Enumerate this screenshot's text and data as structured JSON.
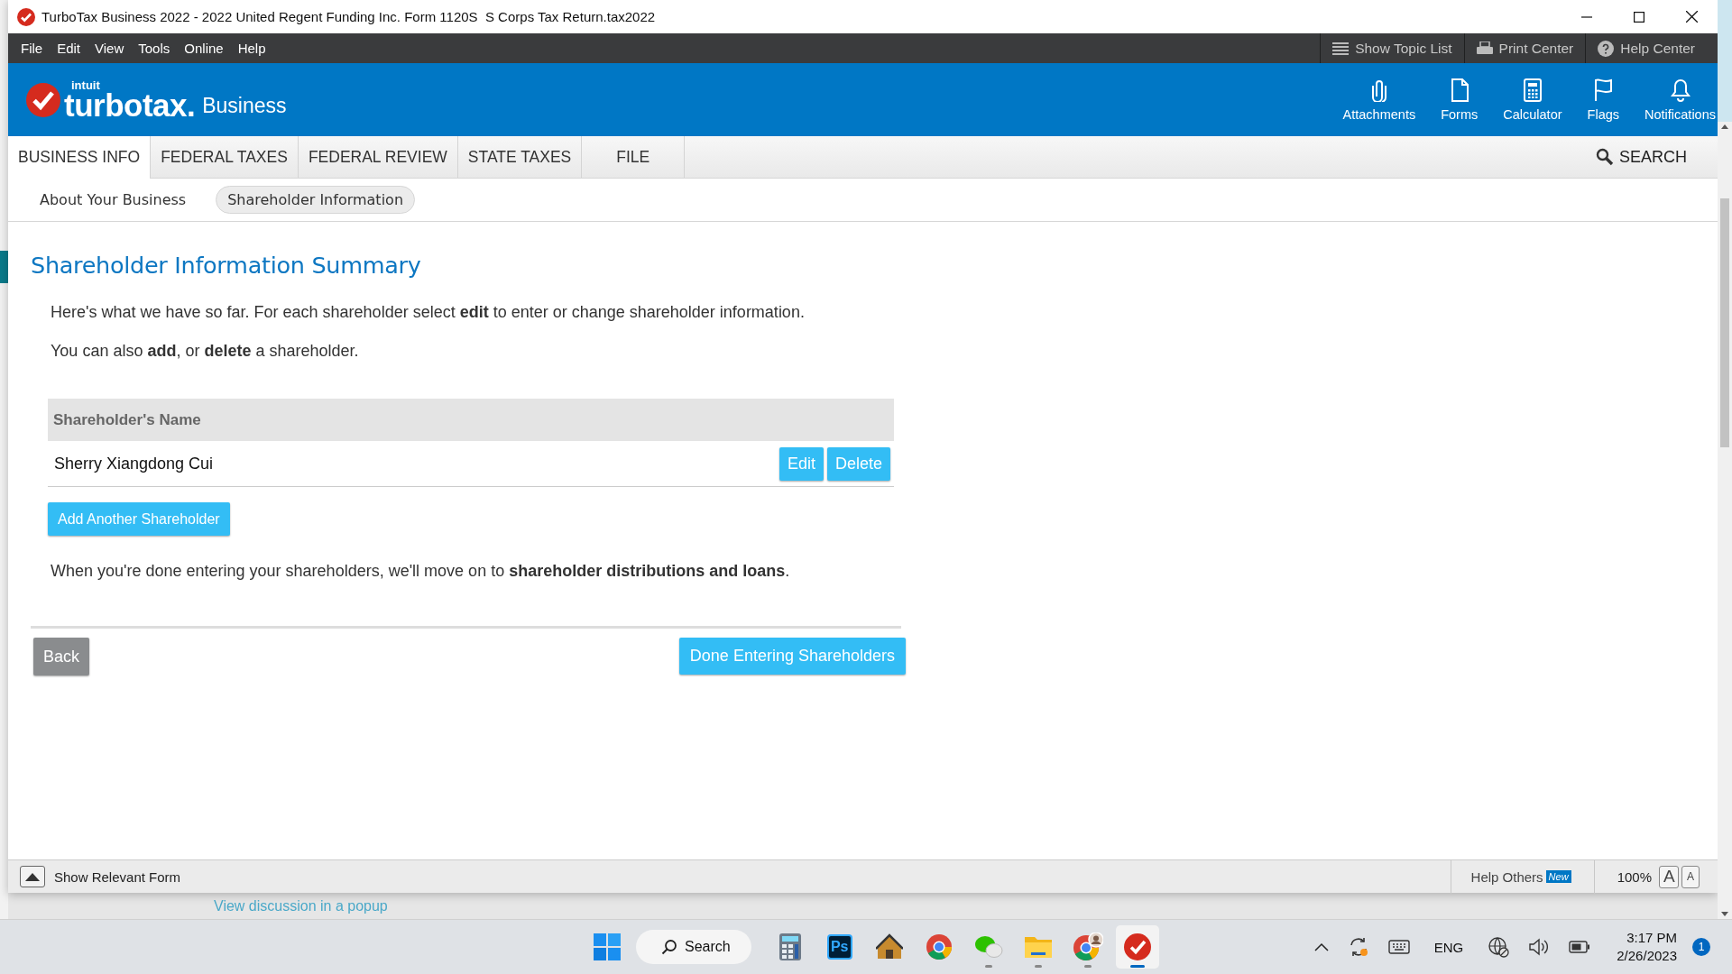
{
  "window": {
    "title": "TurboTax Business 2022 - 2022 United Regent Funding Inc. Form 1120S  S Corps Tax Return.tax2022"
  },
  "menu": [
    "File",
    "Edit",
    "View",
    "Tools",
    "Online",
    "Help"
  ],
  "top_tools": [
    {
      "kind": "list",
      "label": "Show Topic List"
    },
    {
      "kind": "print",
      "label": "Print Center"
    },
    {
      "kind": "help",
      "label": "Help Center"
    }
  ],
  "brand": {
    "small": "intuit",
    "name": "turbotax.",
    "suffix": "Business"
  },
  "header_actions": [
    {
      "kind": "attachments",
      "label": "Attachments"
    },
    {
      "kind": "forms",
      "label": "Forms"
    },
    {
      "kind": "calculator",
      "label": "Calculator"
    },
    {
      "kind": "flags",
      "label": "Flags"
    },
    {
      "kind": "notifications",
      "label": "Notifications"
    }
  ],
  "tabs": [
    {
      "label": "BUSINESS INFO",
      "selected": true
    },
    {
      "label": "FEDERAL TAXES",
      "selected": false
    },
    {
      "label": "FEDERAL REVIEW",
      "selected": false
    },
    {
      "label": "STATE TAXES",
      "selected": false
    },
    {
      "label": "FILE",
      "selected": false
    }
  ],
  "search": {
    "label": "SEARCH"
  },
  "subnav": [
    {
      "label": "About Your Business",
      "selected": false
    },
    {
      "label": "Shareholder Information",
      "selected": true
    }
  ],
  "page": {
    "heading": "Shareholder Information Summary",
    "intro": [
      "Here's what we have so far. For each shareholder select **edit** to enter or change shareholder information.",
      "You can also **add**, or **delete** a shareholder."
    ],
    "table": {
      "columns": [
        "Shareholder's Name"
      ],
      "rows": [
        {
          "name": "Sherry Xiangdong Cui",
          "actions": [
            "Edit",
            "Delete"
          ]
        }
      ]
    },
    "add_button": "Add Another Shareholder",
    "closing": "When you're done entering your shareholders, we'll move on to **shareholder distributions and loans**.",
    "back_button": "Back",
    "continue_button": "Done Entering Shareholders"
  },
  "status_bar": {
    "show_form": "Show Relevant Form",
    "help_others": "Help Others",
    "badge": "New",
    "zoom": "100%",
    "font_buttons": [
      "A",
      "A"
    ]
  },
  "background": {
    "link": "View discussion in a popup"
  },
  "taskbar": {
    "search": "Search",
    "apps": [
      {
        "kind": "calculator",
        "running": false,
        "selected": false
      },
      {
        "kind": "photoshop",
        "label": "Ps",
        "running": false,
        "selected": false
      },
      {
        "kind": "house",
        "running": false,
        "selected": false
      },
      {
        "kind": "chrome",
        "running": false,
        "selected": false
      },
      {
        "kind": "chat",
        "running": true,
        "selected": false
      },
      {
        "kind": "folder",
        "running": true,
        "selected": false
      },
      {
        "kind": "chrome-profile",
        "running": true,
        "selected": false
      },
      {
        "kind": "turbotax",
        "running": true,
        "selected": true
      }
    ],
    "tray": {
      "language": "ENG",
      "time": "3:17 PM",
      "date": "2/26/2023",
      "notifications": "1"
    }
  }
}
